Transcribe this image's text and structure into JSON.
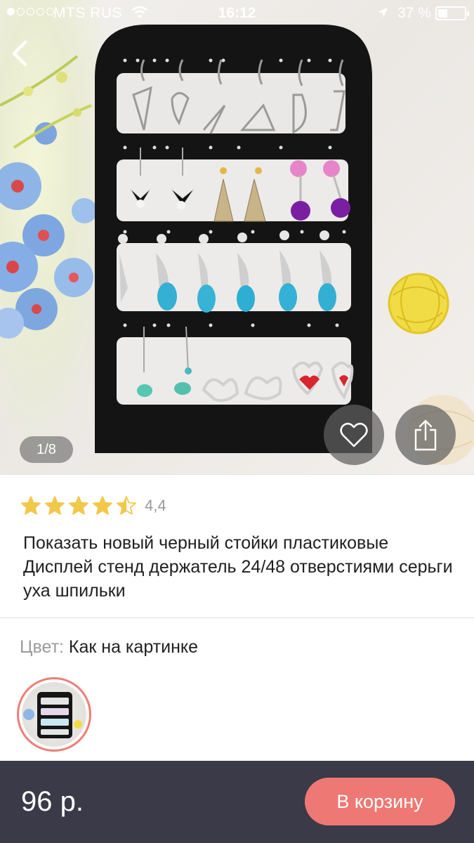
{
  "status_bar": {
    "carrier": "MTS RUS",
    "time": "16:12",
    "battery_percent": "37 %",
    "battery_level": 0.37,
    "signal_bars": 1
  },
  "gallery": {
    "counter": "1/8",
    "total_images": 8,
    "current_image": 1
  },
  "product": {
    "rating_stars": 4.4,
    "rating_value": "4,4",
    "title": "Показать новый черный стойки пластиковые Дисплей стенд держатель 24/48 отверстиями серьги уха шпильки"
  },
  "options": {
    "color_label": "Цвет:",
    "color_value": "Как на картинке"
  },
  "bottom_bar": {
    "price": "96 р.",
    "cart_button": "В корзину"
  },
  "icons": {
    "back": "chevron-left-icon",
    "favorite": "heart-outline-icon",
    "share": "share-icon",
    "star": "star-icon",
    "wifi": "wifi-icon",
    "location": "location-arrow-icon",
    "battery": "battery-icon"
  },
  "colors": {
    "star": "#f2c84b",
    "accent": "#ee7873",
    "bottom_bar": "#3a3a48",
    "swatch_ring": "#ef7d76"
  }
}
